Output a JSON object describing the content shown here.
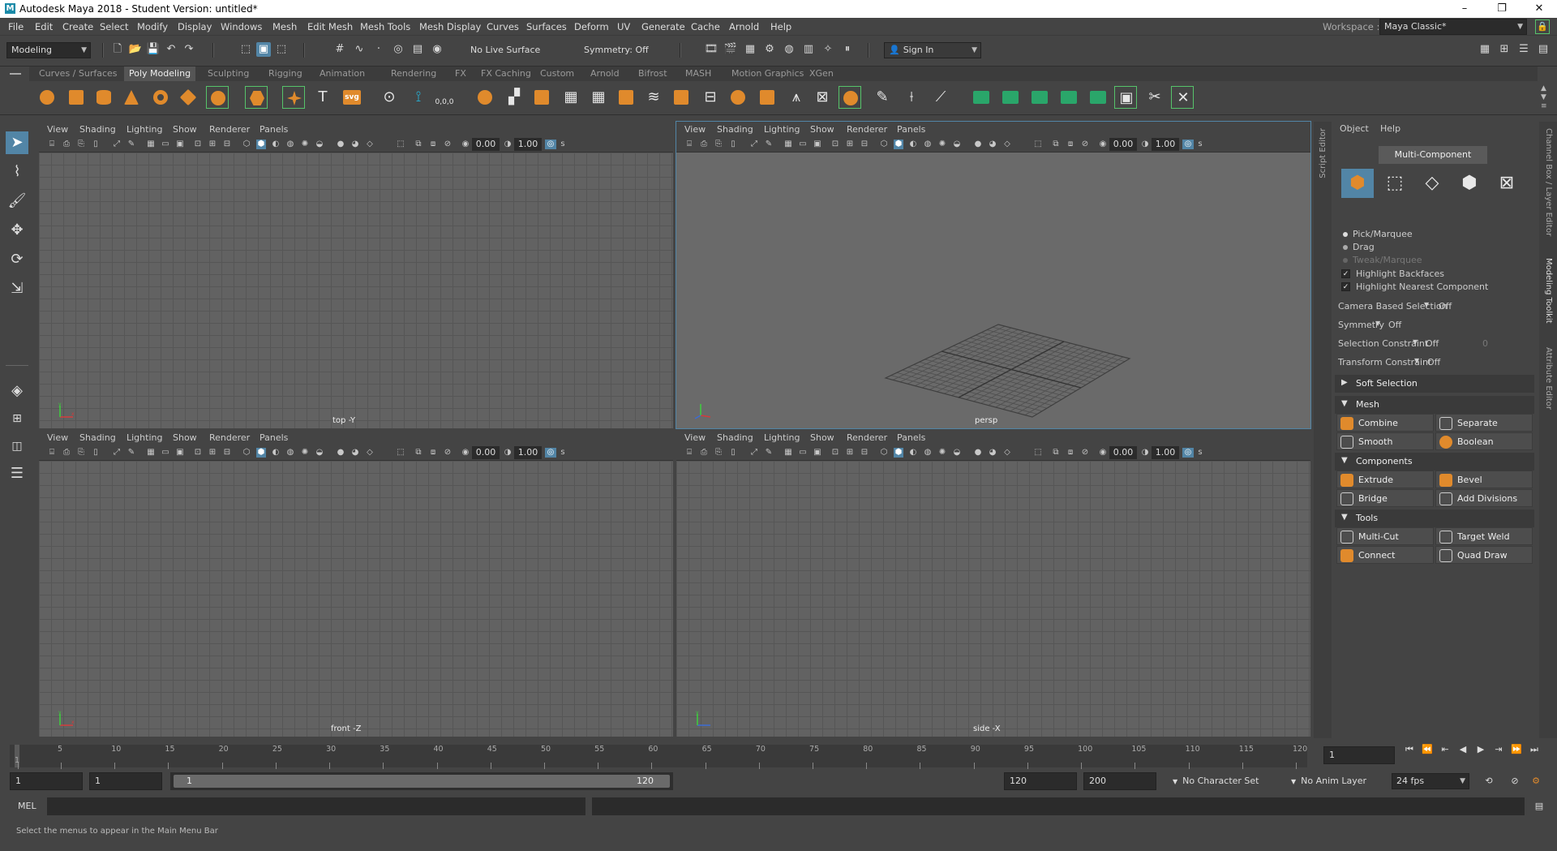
{
  "title_bar": {
    "title": "Autodesk Maya 2018 - Student Version: untitled*",
    "logo_letter": "M",
    "minimize": "–",
    "maximize": "❐",
    "close": "✕"
  },
  "menus": [
    "File",
    "Edit",
    "Create",
    "Select",
    "Modify",
    "Display",
    "Windows",
    "Mesh",
    "Edit Mesh",
    "Mesh Tools",
    "Mesh Display",
    "Curves",
    "Surfaces",
    "Deform",
    "UV",
    "Generate",
    "Cache",
    "Arnold",
    "Help"
  ],
  "workspace": {
    "label": "Workspace :",
    "value": "Maya Classic*"
  },
  "status_line": {
    "menu_set": "Modeling",
    "live_surface": "No Live Surface",
    "symmetry": "Symmetry: Off",
    "sign_in": "Sign In"
  },
  "shelf_tabs": [
    "Curves / Surfaces",
    "Poly Modeling",
    "Sculpting",
    "Rigging",
    "Animation",
    "Rendering",
    "FX",
    "FX Caching",
    "Custom",
    "Arnold",
    "Bifrost",
    "MASH",
    "Motion Graphics",
    "XGen"
  ],
  "shelf_active_tab": "Poly Modeling",
  "shelf_text_icons": {
    "text_tool": "T",
    "svg_tool": "svg",
    "coords": "0,0,0"
  },
  "panel_menu": [
    "View",
    "Shading",
    "Lighting",
    "Show",
    "Renderer",
    "Panels"
  ],
  "panel_toolbar": {
    "value_a": "0.00",
    "value_b": "1.00",
    "suffix": "s"
  },
  "viewports": {
    "top": {
      "label": "top -Y"
    },
    "persp": {
      "label": "persp"
    },
    "front": {
      "label": "front -Z"
    },
    "side": {
      "label": "side -X"
    }
  },
  "side_tabs": {
    "script_editor": "Script Editor",
    "channel_box": "Channel Box / Layer Editor",
    "modeling_toolkit": "Modeling Toolkit",
    "attribute_editor": "Attribute Editor"
  },
  "toolkit": {
    "menu": [
      "Object",
      "Help"
    ],
    "mode_button": "Multi-Component",
    "pick_modes": [
      {
        "label": "Pick/Marquee",
        "enabled": true
      },
      {
        "label": "Drag",
        "enabled": true
      },
      {
        "label": "Tweak/Marquee",
        "enabled": false
      }
    ],
    "checks": [
      {
        "label": "Highlight Backfaces",
        "checked": true
      },
      {
        "label": "Highlight Nearest Component",
        "checked": true
      }
    ],
    "options": [
      {
        "label": "Camera Based Selection",
        "value": "Off"
      },
      {
        "label": "Symmetry",
        "value": "Off"
      },
      {
        "label": "Selection Constraint",
        "value": "Off",
        "extra": "0"
      },
      {
        "label": "Transform Constraint",
        "value": "Off"
      }
    ],
    "soft_selection": "Soft Selection",
    "sections": [
      {
        "title": "Mesh",
        "buttons": [
          "Combine",
          "Separate",
          "Smooth",
          "Boolean"
        ]
      },
      {
        "title": "Components",
        "buttons": [
          "Extrude",
          "Bevel",
          "Bridge",
          "Add Divisions"
        ]
      },
      {
        "title": "Tools",
        "buttons": [
          "Multi-Cut",
          "Target Weld",
          "Connect",
          "Quad Draw"
        ]
      }
    ]
  },
  "timeline": {
    "current_frame_box": "1",
    "ticks": [
      "1",
      "5",
      "10",
      "15",
      "20",
      "25",
      "30",
      "35",
      "40",
      "45",
      "50",
      "55",
      "60",
      "65",
      "70",
      "75",
      "80",
      "85",
      "90",
      "95",
      "100",
      "105",
      "110",
      "115",
      "120"
    ]
  },
  "range": {
    "start": "1",
    "playback_start": "1",
    "slider_start": "1",
    "slider_end": "120",
    "playback_end": "120",
    "end": "200",
    "character_set": "No Character Set",
    "anim_layer": "No Anim Layer",
    "fps": "24 fps"
  },
  "command_line": {
    "label": "MEL"
  },
  "help_line": {
    "text": "Select the menus to appear in the Main Menu Bar"
  },
  "colors": {
    "accent": "#5285a6",
    "shelf_orange": "#e08a2c",
    "shelf_green": "#2aa66a",
    "background": "#444444"
  }
}
